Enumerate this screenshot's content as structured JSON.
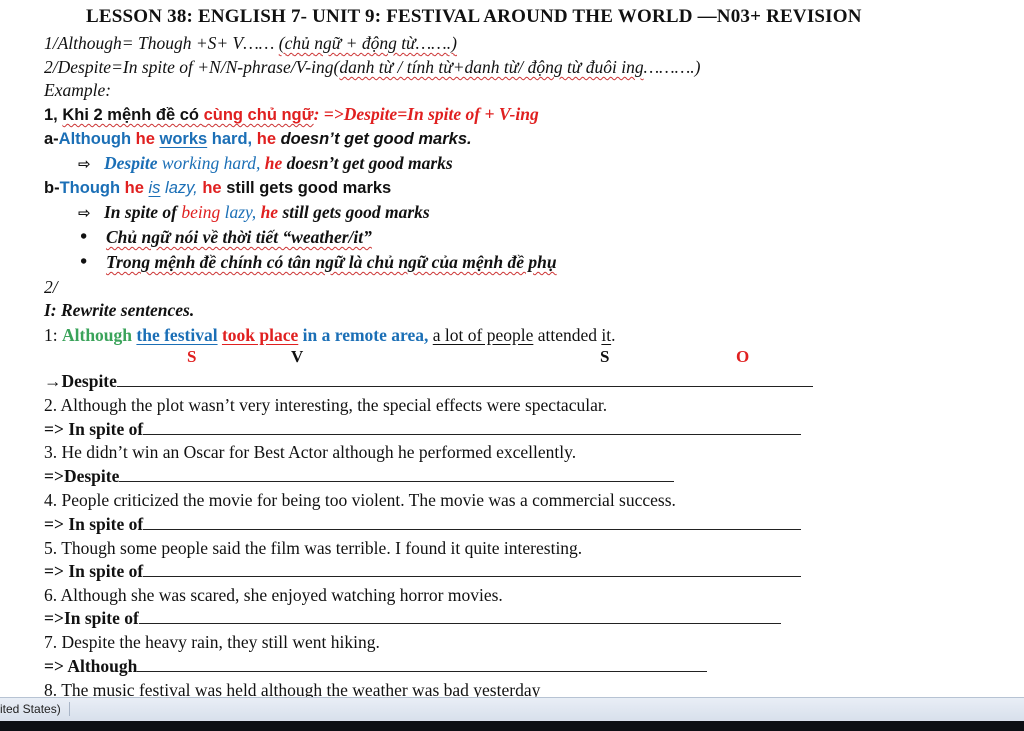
{
  "title": "LESSON 38: ENGLISH 7- UNIT 9: FESTIVAL  AROUND  THE WORLD —N03+ REVISION",
  "rule1": {
    "text": "1/Although= Though +S+ V……",
    "note": "(chủ ngữ + động từ…….)"
  },
  "rule2": {
    "text": "2/Despite=In spite of +N/N-phrase/V-ing(",
    "note": "danh từ / tính từ+danh từ/ động từ đuôi ing",
    "end": "……….)"
  },
  "example_label": "Example:",
  "case1": {
    "prefix": "1, ",
    "lead": "Khi 2 mệnh đề có ",
    "same_subject": "cùng chủ ngữ",
    "rule": ": =>Despite=In spite of + V-ing"
  },
  "ex_a": {
    "tag": "a-",
    "although": "Although",
    "he1": "he",
    "works": "works",
    "hard": "hard,",
    "he2": "he",
    "rest": "doesn’t get good marks."
  },
  "ex_a_ans": {
    "despite": "Despite",
    "working": "working hard,",
    "he": "he",
    "rest": "doesn’t get good marks"
  },
  "ex_b": {
    "tag": "b-",
    "though": "Though",
    "he1": "he",
    "is": "is",
    "lazy": "lazy,",
    "he2": "he",
    "rest": "still gets good marks"
  },
  "ex_b_ans": {
    "inspite": "In spite of",
    "being": "being",
    "lazy": "lazy,",
    "he": "he",
    "rest": "still gets good marks"
  },
  "bullets": [
    "Chủ ngữ nói về thời tiết “weather/it”",
    "Trong mệnh đề chính có tân ngữ là chủ ngữ của mệnh đề phụ"
  ],
  "case2_label": "2/",
  "exercise_title": "I: Rewrite sentences.",
  "q1": {
    "num": "1: ",
    "although": "Although",
    "subject": "the festival",
    "verb": "took place",
    "middle": "in a remote area,",
    "people": "a lot of people",
    "attended": "attended",
    "obj": "it",
    "end": ".",
    "labels": {
      "s1": "S",
      "v": "V",
      "s2": "S",
      "o": "O"
    }
  },
  "q1_ans": "→Despite",
  "questions": [
    {
      "num": "2.",
      "text": "Although the plot wasn’t very interesting, the special effects were spectacular.",
      "prompt": "=> In spite of"
    },
    {
      "num": "3.",
      "text": "He didn’t win an Oscar for Best Actor although he performed excellently.",
      "prompt": "=>Despite"
    },
    {
      "num": "4.",
      "text": "People criticized the movie for being too violent. The movie was a commercial success.",
      "prompt": "=> In spite of"
    },
    {
      "num": "5.",
      "text": "Though some people said the film was terrible. I found it quite interesting.",
      "prompt": "=> In spite of"
    },
    {
      "num": "6.",
      "text": "Although she was scared, she enjoyed watching horror movies.",
      "prompt": "=>In spite of"
    },
    {
      "num": "7.",
      "text": "Despite the heavy rain, they still went hiking.",
      "prompt": "=> Although"
    },
    {
      "num": "8.",
      "text": "The music festival was held although the weather was bad yesterday"
    }
  ],
  "statusbar": {
    "language": "ited States)"
  },
  "icons": {
    "arrow": "right-arrow-icon",
    "bullet": "bullet-icon"
  },
  "colors": {
    "red": "#e02020",
    "blue": "#1b6fb6",
    "green": "#3aa35a"
  }
}
